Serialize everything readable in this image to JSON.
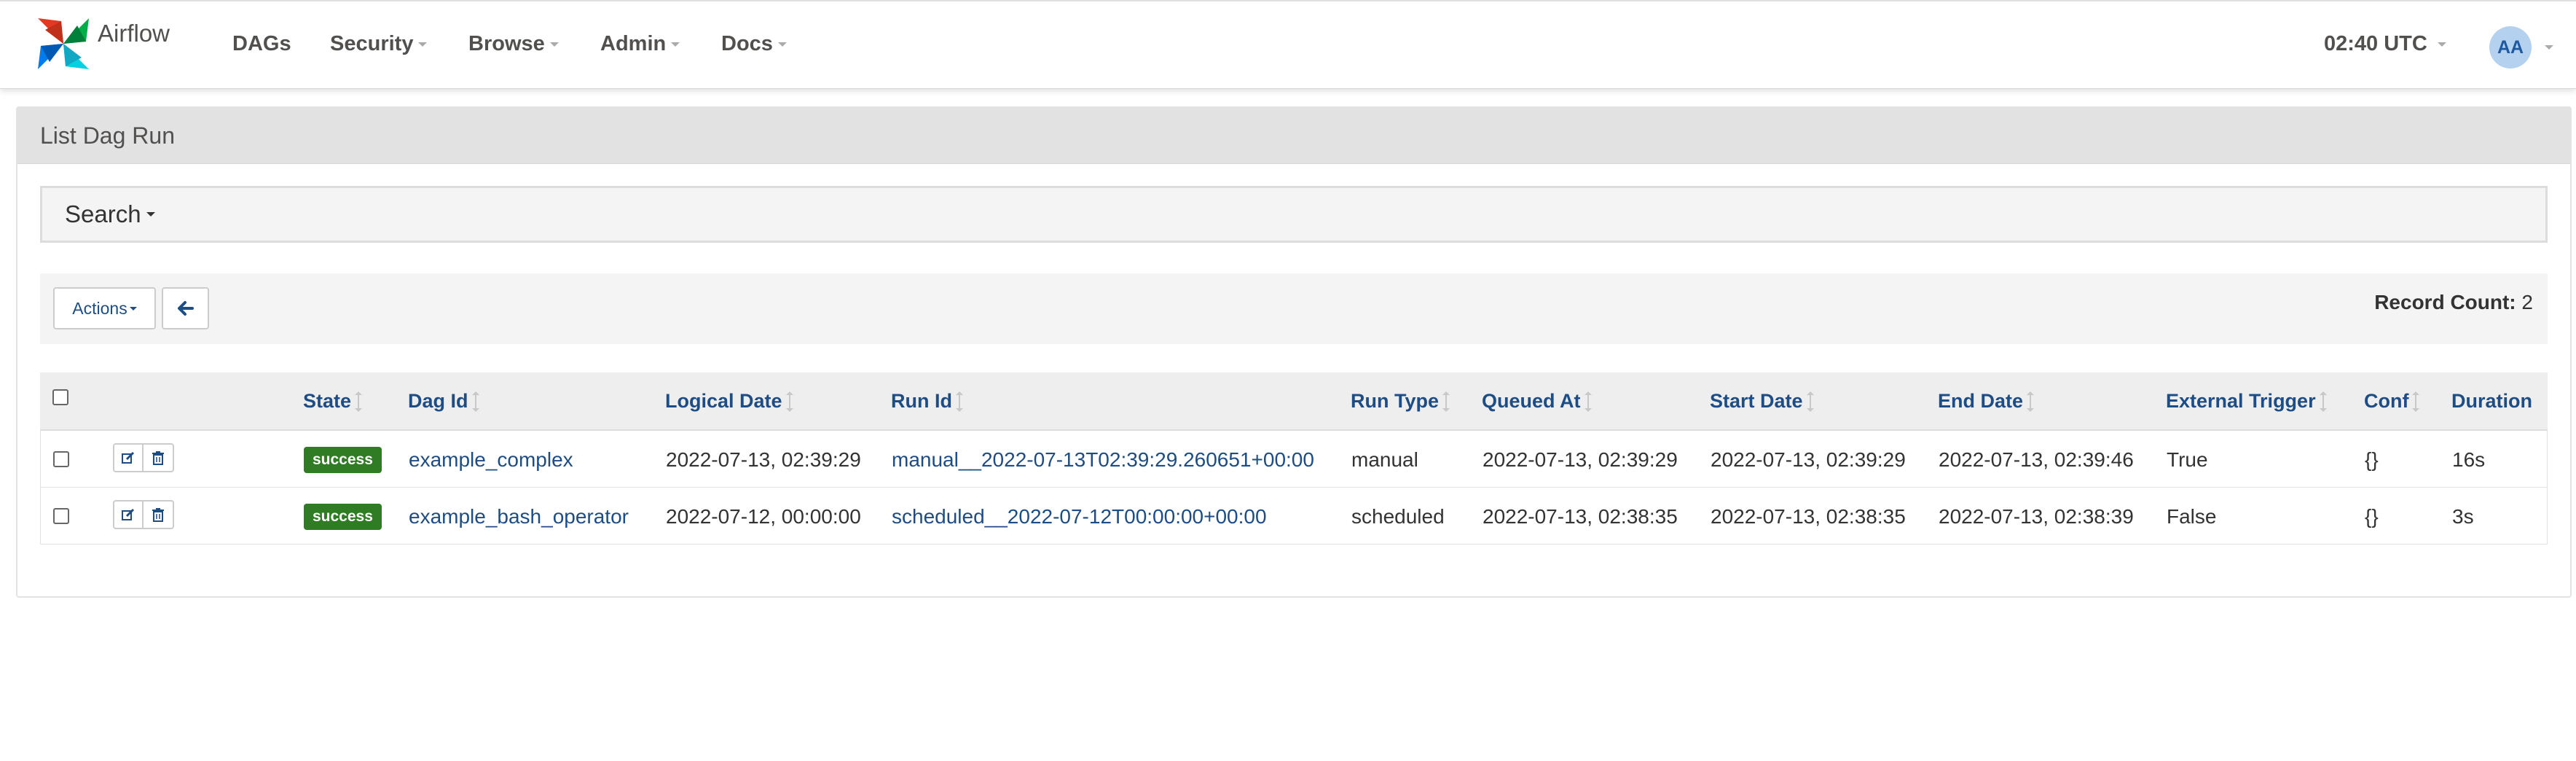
{
  "navbar": {
    "brand": "Airflow",
    "menu": [
      "DAGs",
      "Security",
      "Browse",
      "Admin",
      "Docs"
    ],
    "clock": "02:40 UTC",
    "user_initials": "AA"
  },
  "panel": {
    "title": "List Dag Run",
    "search_label": "Search",
    "actions_label": "Actions",
    "record_count_label": "Record Count:",
    "record_count_value": "2"
  },
  "table": {
    "columns": [
      "State",
      "Dag Id",
      "Logical Date",
      "Run Id",
      "Run Type",
      "Queued At",
      "Start Date",
      "End Date",
      "External Trigger",
      "Conf",
      "Duration"
    ],
    "rows": [
      {
        "state": "success",
        "dag_id": "example_complex",
        "logical_date": "2022-07-13, 02:39:29",
        "run_id": "manual__2022-07-13T02:39:29.260651+00:00",
        "run_type": "manual",
        "queued_at": "2022-07-13, 02:39:29",
        "start_date": "2022-07-13, 02:39:29",
        "end_date": "2022-07-13, 02:39:46",
        "external_trigger": "True",
        "conf": "{}",
        "duration": "16s"
      },
      {
        "state": "success",
        "dag_id": "example_bash_operator",
        "logical_date": "2022-07-12, 00:00:00",
        "run_id": "scheduled__2022-07-12T00:00:00+00:00",
        "run_type": "scheduled",
        "queued_at": "2022-07-13, 02:38:35",
        "start_date": "2022-07-13, 02:38:35",
        "end_date": "2022-07-13, 02:38:39",
        "external_trigger": "False",
        "conf": "{}",
        "duration": "3s"
      }
    ]
  },
  "colors": {
    "link": "#1d4d84",
    "success": "#2f7c25",
    "header_bg": "#e2e2e2"
  }
}
